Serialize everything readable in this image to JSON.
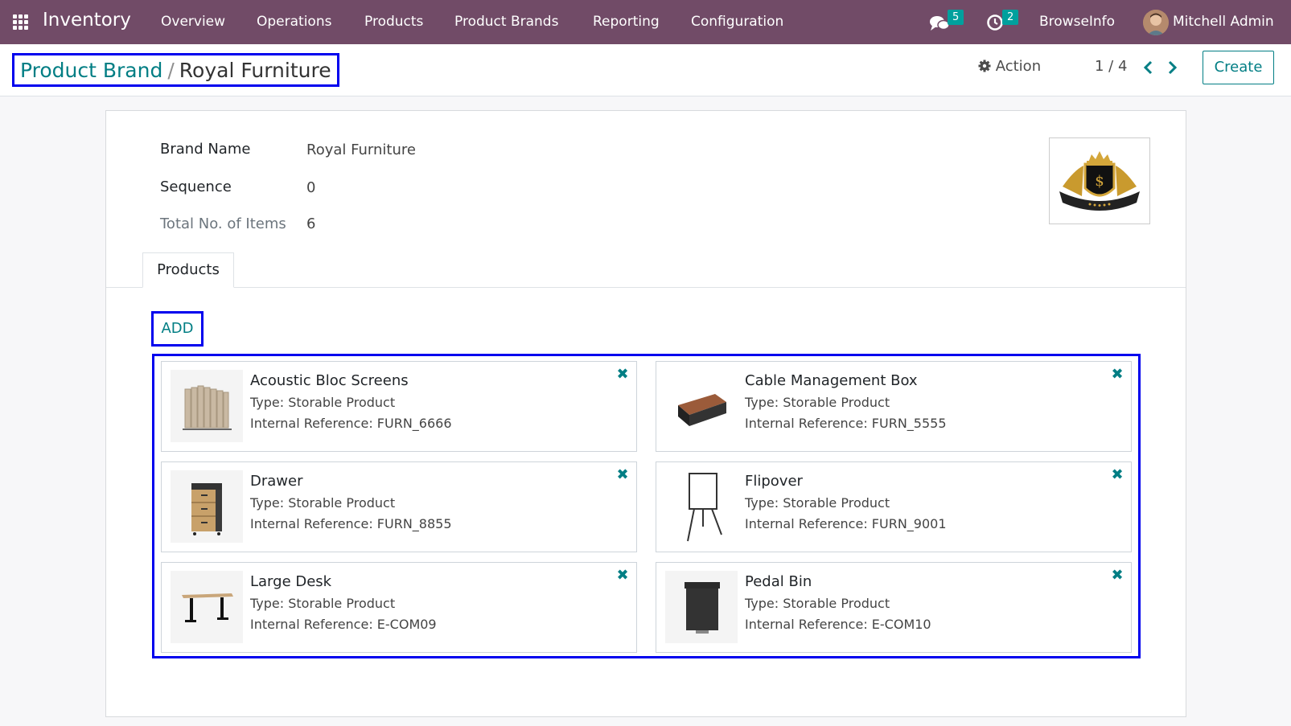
{
  "navbar": {
    "app_title": "Inventory",
    "menus": [
      "Overview",
      "Operations",
      "Products",
      "Product Brands",
      "Reporting",
      "Configuration"
    ],
    "messages_count": "5",
    "activities_count": "2",
    "company": "BrowseInfo",
    "user": "Mitchell Admin"
  },
  "control_panel": {
    "breadcrumb_parent": "Product Brand",
    "breadcrumb_separator": "/",
    "breadcrumb_current": "Royal Furniture",
    "action_label": "Action",
    "pager": "1 / 4",
    "create_label": "Create"
  },
  "form": {
    "brand_name_label": "Brand Name",
    "brand_name_value": "Royal Furniture",
    "sequence_label": "Sequence",
    "sequence_value": "0",
    "total_items_label": "Total No. of Items",
    "total_items_value": "6",
    "tab_products": "Products",
    "add_label": "ADD"
  },
  "products": [
    {
      "name": "Acoustic Bloc Screens",
      "type": "Type: Storable Product",
      "ref": "Internal Reference: FURN_6666",
      "icon": "screen-icon"
    },
    {
      "name": "Cable Management Box",
      "type": "Type: Storable Product",
      "ref": "Internal Reference: FURN_5555",
      "icon": "box-icon"
    },
    {
      "name": "Drawer",
      "type": "Type: Storable Product",
      "ref": "Internal Reference: FURN_8855",
      "icon": "drawer-icon"
    },
    {
      "name": "Flipover",
      "type": "Type: Storable Product",
      "ref": "Internal Reference: FURN_9001",
      "icon": "flipchart-icon"
    },
    {
      "name": "Large Desk",
      "type": "Type: Storable Product",
      "ref": "Internal Reference: E-COM09",
      "icon": "desk-icon"
    },
    {
      "name": "Pedal Bin",
      "type": "Type: Storable Product",
      "ref": "Internal Reference: E-COM10",
      "icon": "bin-icon"
    }
  ],
  "colors": {
    "navbar": "#714b67",
    "accent": "#017e84",
    "badge": "#00a09d",
    "highlight": "#0000ee"
  }
}
